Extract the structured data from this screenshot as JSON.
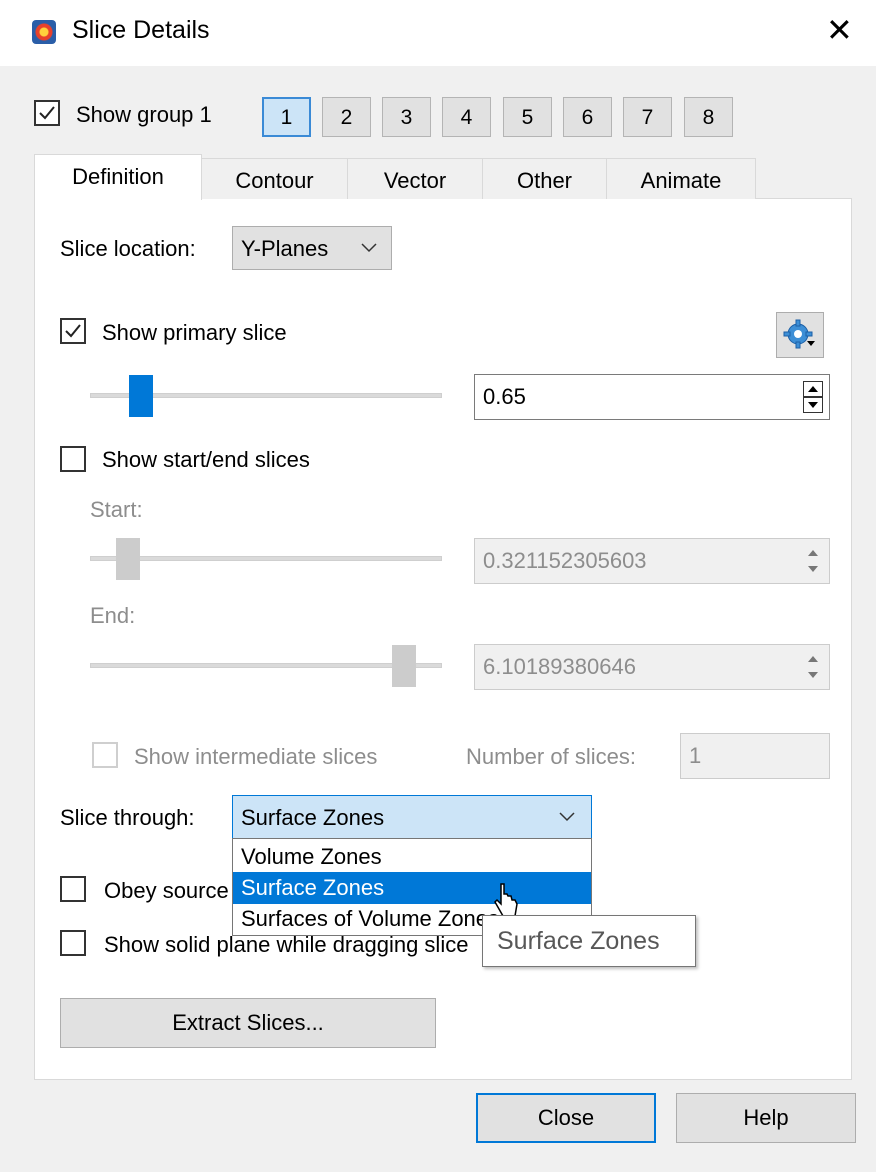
{
  "window": {
    "title": "Slice Details"
  },
  "group": {
    "show_label": "Show group 1",
    "show_checked": true,
    "buttons": [
      "1",
      "2",
      "3",
      "4",
      "5",
      "6",
      "7",
      "8"
    ],
    "selected": "1"
  },
  "tabs": [
    "Definition",
    "Contour",
    "Vector",
    "Other",
    "Animate"
  ],
  "active_tab": "Definition",
  "definition": {
    "slice_location_label": "Slice location:",
    "slice_location_value": "Y-Planes",
    "show_primary_label": "Show primary slice",
    "show_primary_checked": true,
    "primary_value": "0.65",
    "primary_slider_fraction": 0.12,
    "show_start_end_label": "Show start/end slices",
    "show_start_end_checked": false,
    "start_label": "Start:",
    "start_value": "0.321152305603",
    "start_slider_fraction": 0.08,
    "end_label": "End:",
    "end_value": "6.10189380646",
    "end_slider_fraction": 0.92,
    "show_intermediate_label": "Show intermediate slices",
    "number_of_slices_label": "Number of slices:",
    "number_of_slices_value": "1",
    "slice_through_label": "Slice through:",
    "slice_through_value": "Surface Zones",
    "slice_through_options": [
      "Volume Zones",
      "Surface Zones",
      "Surfaces of Volume Zones"
    ],
    "slice_through_highlighted": "Surface Zones",
    "obey_source_label": "Obey source zone blanking",
    "show_solid_label": "Show solid plane while dragging slice",
    "extract_label": "Extract Slices...",
    "tooltip": "Surface Zones"
  },
  "footer": {
    "close_label": "Close",
    "help_label": "Help"
  },
  "colors": {
    "accent": "#0078d7",
    "selected_bg": "#cce4f7"
  }
}
